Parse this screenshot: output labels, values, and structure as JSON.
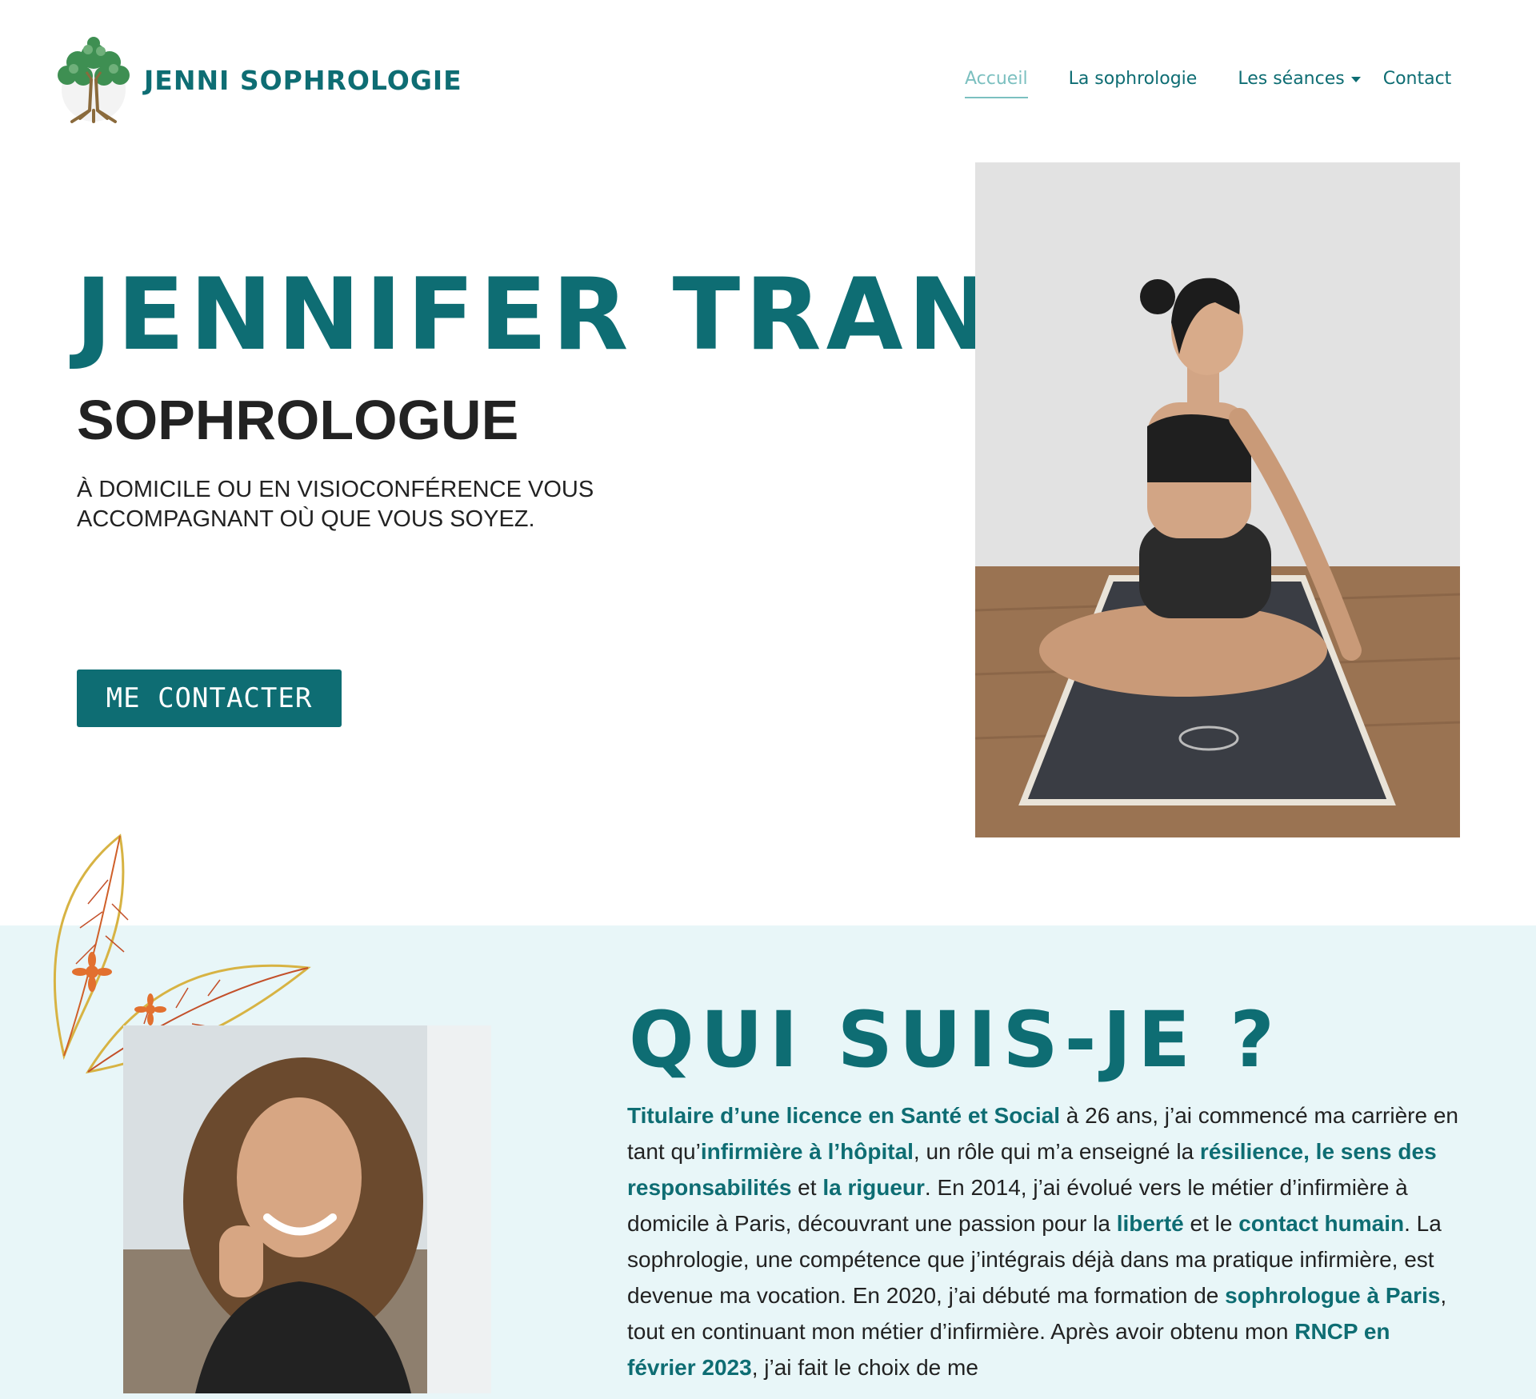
{
  "brand": {
    "name": "JENNI SOPHROLOGIE"
  },
  "nav": {
    "items": [
      {
        "label": "Accueil"
      },
      {
        "label": "La sophrologie"
      },
      {
        "label": "Les séances"
      },
      {
        "label": "Contact"
      }
    ]
  },
  "hero": {
    "title": "JENNIFER TRAN",
    "subtitle": "SOPHROLOGUE",
    "text": "À domicile ou en visioconférence vous accompagnant où que vous soyez.",
    "cta_label": "ME CONTACTER"
  },
  "about": {
    "title": "QUI SUIS-JE ?",
    "p": [
      {
        "t": "Titulaire d’une licence en Santé et Social",
        "hl": true
      },
      {
        "t": " à 26 ans, j’ai commencé ma carrière en tant qu’",
        "hl": false
      },
      {
        "t": "infirmière à l’hôpital",
        "hl": true
      },
      {
        "t": ", un rôle qui m’a enseigné la ",
        "hl": false
      },
      {
        "t": "résilience, le sens des responsabilités",
        "hl": true
      },
      {
        "t": " et ",
        "hl": false
      },
      {
        "t": "la rigueur",
        "hl": true
      },
      {
        "t": ".  En 2014, j’ai évolué vers le métier d’infirmière à domicile à Paris, découvrant une passion pour la ",
        "hl": false
      },
      {
        "t": "liberté",
        "hl": true
      },
      {
        "t": " et le ",
        "hl": false
      },
      {
        "t": "contact humain",
        "hl": true
      },
      {
        "t": ". La sophrologie, une compétence que j’intégrais déjà dans ma pratique infirmière, est devenue ma vocation. En 2020, j’ai débuté ma formation de ",
        "hl": false
      },
      {
        "t": "sophrologue à Paris",
        "hl": true
      },
      {
        "t": ", tout en continuant mon métier d’infirmière. Après avoir obtenu mon ",
        "hl": false
      },
      {
        "t": "RNCP en février 2023",
        "hl": true
      },
      {
        "t": ", j’ai fait le choix de me",
        "hl": false
      }
    ]
  },
  "colors": {
    "accent": "#0e6d73",
    "nav_active": "#7cc0c0",
    "section_bg": "#e8f6f8"
  },
  "icons": {
    "logo": "tree-of-life-icon",
    "nav_dropdown": "chevron-down-icon",
    "decoration": "leaf-decoration-icon"
  }
}
